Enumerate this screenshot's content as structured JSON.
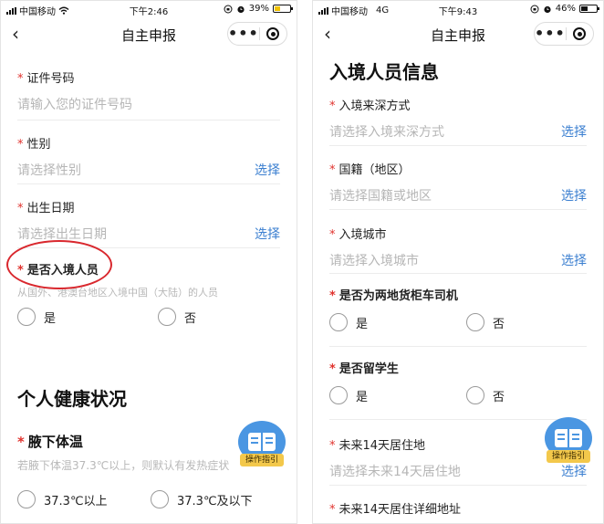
{
  "left": {
    "status": {
      "carrier": "中国移动",
      "time": "下午2:46",
      "battery": "39%",
      "battery_level": 0.39
    },
    "nav": {
      "back": "<",
      "title": "自主申报",
      "more": "•••"
    },
    "fields": [
      {
        "label": "证件号码",
        "placeholder": "请输入您的证件号码"
      },
      {
        "label": "性别",
        "placeholder": "请选择性别",
        "action": "选择"
      },
      {
        "label": "出生日期",
        "placeholder": "请选择出生日期",
        "action": "选择"
      }
    ],
    "entry_question": {
      "label": "是否入境人员",
      "hint": "从国外、港澳台地区入境中国（大陆）的人员",
      "options": [
        "是",
        "否"
      ]
    },
    "section_title": "个人健康状况",
    "temperature": {
      "label": "腋下体温",
      "hint": "若腋下体温37.3℃以上，则默认有发热症状",
      "options": [
        "37.3℃以上",
        "37.3℃及以下"
      ]
    },
    "guide_label": "操作指引"
  },
  "right": {
    "status": {
      "carrier": "中国移动",
      "network": "4G",
      "time": "下午9:43",
      "battery": "46%",
      "battery_level": 0.46
    },
    "nav": {
      "back": "<",
      "title": "自主申报",
      "more": "•••"
    },
    "section_title": "入境人员信息",
    "fields": [
      {
        "label": "入境来深方式",
        "placeholder": "请选择入境来深方式",
        "action": "选择"
      },
      {
        "label": "国籍（地区）",
        "placeholder": "请选择国籍或地区",
        "action": "选择"
      },
      {
        "label": "入境城市",
        "placeholder": "请选择入境城市",
        "action": "选择"
      }
    ],
    "questions": [
      {
        "label": "是否为两地货柜车司机",
        "options": [
          "是",
          "否"
        ]
      },
      {
        "label": "是否留学生",
        "options": [
          "是",
          "否"
        ]
      }
    ],
    "residence": {
      "label": "未来14天居住地",
      "placeholder": "请选择未来14天居住地",
      "action": "选择"
    },
    "address": {
      "label": "未来14天居住详细地址"
    },
    "guide_label": "操作指引"
  }
}
